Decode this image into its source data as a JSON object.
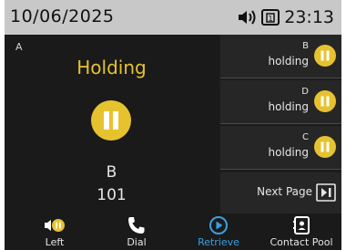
{
  "status_bar": {
    "date": "10/06/2025",
    "time": "23:13",
    "icons": [
      "speaker-volume-icon",
      "line-key-icon"
    ]
  },
  "active_call": {
    "line": "A",
    "state": "Holding",
    "name": "B",
    "number": "101",
    "icon": "pause-icon",
    "accent_color": "#e6c22f"
  },
  "call_list": [
    {
      "name": "B",
      "state": "holding",
      "icon": "pause-icon"
    },
    {
      "name": "D",
      "state": "holding",
      "icon": "pause-icon"
    },
    {
      "name": "C",
      "state": "holding",
      "icon": "pause-icon"
    }
  ],
  "next_page": {
    "label": "Next Page",
    "icon": "next-page-icon"
  },
  "softkeys": [
    {
      "label": "Left",
      "icon": "speaker-hold-icon"
    },
    {
      "label": "Dial",
      "icon": "phone-handset-icon"
    },
    {
      "label": "Retrieve",
      "icon": "play-circle-icon",
      "active": true,
      "color": "#3aa0e0"
    },
    {
      "label": "Contact Pool",
      "icon": "contact-card-icon"
    }
  ]
}
